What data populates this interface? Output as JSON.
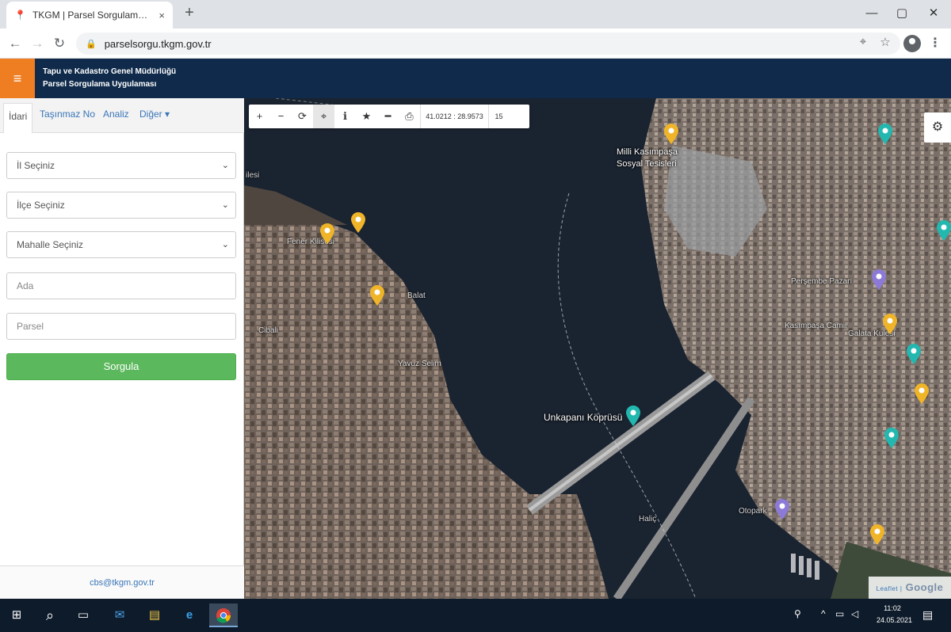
{
  "browser": {
    "tab_title": "TKGM | Parsel Sorgulama Uygula...",
    "tab_close": "×",
    "new_tab": "+",
    "url": "parselsorgu.tkgm.gov.tr",
    "window_controls": {
      "minimize": "—",
      "maximize": "▢",
      "close": "✕"
    }
  },
  "app": {
    "menu_icon": "≡",
    "title_line1": "Tapu ve Kadastro Genel Müdürlüğü",
    "title_line2": "Parsel Sorgulama Uygulaması"
  },
  "sidebar": {
    "tabs": [
      {
        "label": "İdari"
      },
      {
        "label": "Taşınmaz No"
      },
      {
        "label": "Analiz"
      },
      {
        "label": "Diğer ▾"
      }
    ],
    "fields": {
      "il": "İl Seçiniz",
      "ilce": "İlçe Seçiniz",
      "mahalle": "Mahalle Seçiniz",
      "ada_placeholder": "Ada",
      "parsel_placeholder": "Parsel"
    },
    "query_button": "Sorgula",
    "footer": "cbs@tkgm.gov.tr"
  },
  "map": {
    "toolbar": {
      "zoom_in": "+",
      "zoom_out": "−",
      "refresh": "⟳",
      "locate": "⌖",
      "info": "ℹ",
      "bookmark": "★",
      "measure": "━",
      "print": "⎙",
      "coordinates": "41.0212 : 28.9573",
      "zoom_level": "15"
    },
    "settings_icon": "⚙",
    "labels": {
      "milli_kasimpasa": "Milli Kasımpaşa",
      "sosyal_tesisleri": "Sosyal Tesisleri",
      "unkapani": "Unkapanı Köprüsü",
      "hasköy": "Balat",
      "fener": "Fener Kilisesi",
      "ottopasa": "Otopark",
      "halic": "Haliç",
      "galata": "Galata Kulesi",
      "tepebasi": "Kasımpaşa Camii",
      "persembe": "Perşembe Pazarı",
      "cibali": "Cibali",
      "yavuz": "Yavuz Selim",
      "left_edge": "ilesi"
    },
    "attribution": "Google",
    "attribution_prefix": "Leaflet |"
  },
  "taskbar": {
    "start_icon": "⊞",
    "search_icon": "⌕",
    "clock_time": "11:02",
    "clock_date": "24.05.2021"
  }
}
